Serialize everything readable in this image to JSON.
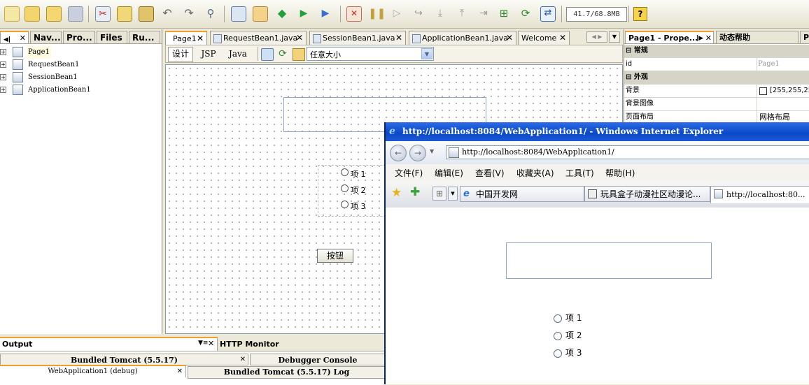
{
  "toolbar": {
    "memory": "41.7/68.8MB",
    "help_label": "?"
  },
  "left_panel": {
    "tabs": [
      "Nav...",
      "Pro...",
      "Files",
      "Ru..."
    ],
    "tree": [
      "Page1",
      "RequestBean1",
      "SessionBean1",
      "ApplicationBean1"
    ]
  },
  "editor": {
    "tabs": [
      "Page1",
      "RequestBean1.java",
      "SessionBean1.java",
      "ApplicationBean1.java",
      "Welcome"
    ],
    "views": [
      "设计",
      "JSP",
      "Java"
    ],
    "size_select": "任意大小",
    "radios": [
      "项 1",
      "项 2",
      "项 3"
    ],
    "button_label": "按钮"
  },
  "properties": {
    "tabs": [
      "Page1 - Prope...",
      "动态帮助",
      "P"
    ],
    "cat_general": "常规",
    "id_label": "id",
    "id_value": "Page1",
    "cat_appearance": "外观",
    "bg_label": "背景",
    "bg_value": "[255,255,25",
    "bgimg_label": "背景图像",
    "layout_label": "页面布局",
    "layout_value": "网格布局"
  },
  "output": {
    "title": "Output",
    "http_monitor": "HTTP Monitor",
    "tabs": [
      "Bundled Tomcat (5.5.17)",
      "Debugger Console",
      "WebApplication1 (debug)",
      "Bundled Tomcat (5.5.17) Log"
    ]
  },
  "ie": {
    "title": "http://localhost:8084/WebApplication1/ - Windows Internet Explorer",
    "address": "http://localhost:8084/WebApplication1/",
    "menu": [
      "文件(F)",
      "编辑(E)",
      "查看(V)",
      "收藏夹(A)",
      "工具(T)",
      "帮助(H)"
    ],
    "tabs": [
      "中国开发网",
      "玩具盒子动漫社区动漫论...",
      "http://localhost:80..."
    ],
    "radios": [
      "项 1",
      "项 2",
      "项 3"
    ]
  }
}
